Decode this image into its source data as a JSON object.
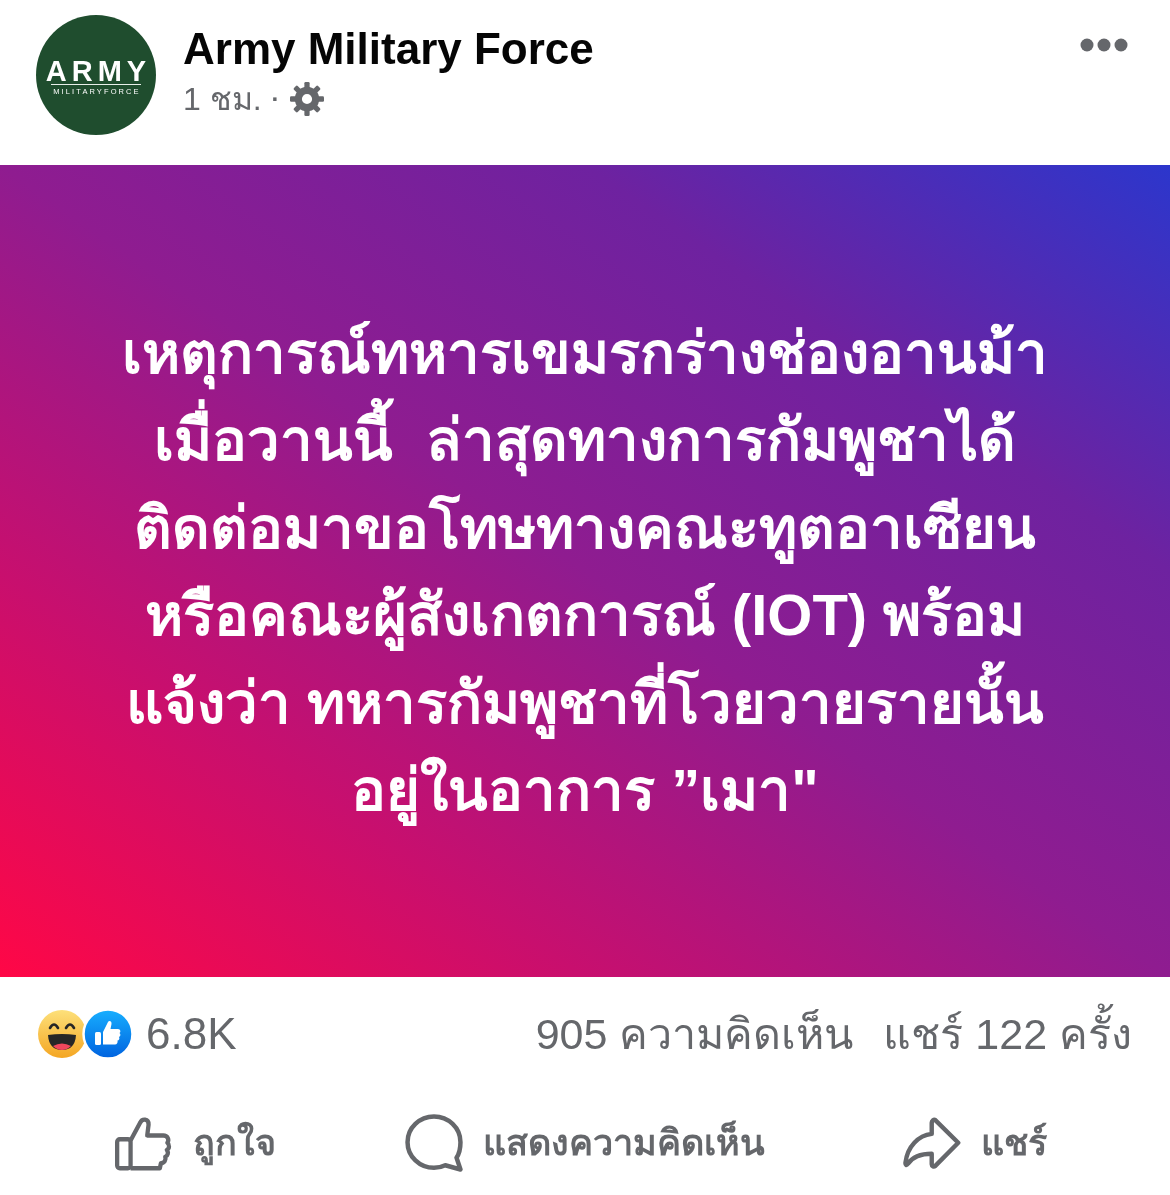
{
  "header": {
    "author": "Army Military Force",
    "logo_text": "ARMY",
    "logo_subtext": "MILITARYFORCE",
    "time": "1 ชม.",
    "separator": "·"
  },
  "banner": {
    "lines": [
      "เหตุการณ์ทหารเขมรกร่างช่องอานม้า",
      "เมื่อวานนี้  ล่าสุดทางการกัมพูชาได้",
      "ติดต่อมาขอโทษทางคณะทูตอาเซียน",
      "หรือคณะผู้สังเกตการณ์ (IOT) พร้อม",
      "แจ้งว่า ทหารกัมพูชาที่โวยวายรายนั้น",
      "อยู่ในอาการ ”เมา\""
    ]
  },
  "stats": {
    "reactions": [
      {
        "kind": "haha"
      },
      {
        "kind": "like"
      }
    ],
    "reaction_count": "6.8K",
    "comments": "905 ความคิดเห็น",
    "shares": "แชร์ 122 ครั้ง"
  },
  "actions": [
    {
      "kind": "like",
      "label": "ถูกใจ"
    },
    {
      "kind": "comment",
      "label": "แสดงความคิดเห็น"
    },
    {
      "kind": "share",
      "label": "แชร์"
    }
  ]
}
